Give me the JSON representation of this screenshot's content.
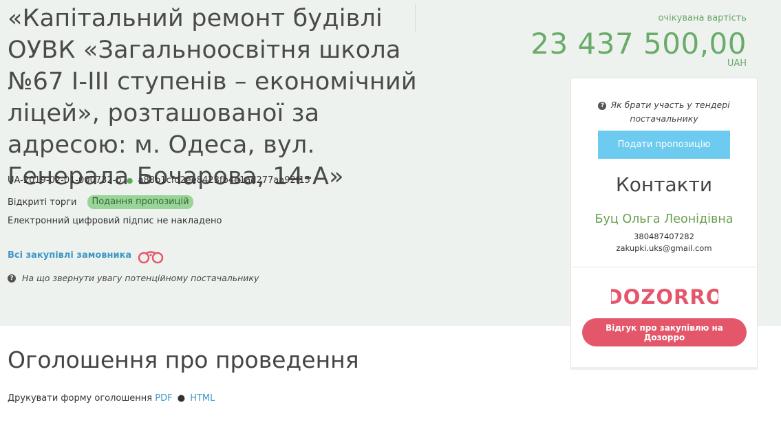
{
  "tender": {
    "title": "«Капітальний ремонт будівлі ОУВК «Загальноосвітня школа №67 І-ІІІ ступенів – економічний ліцей», розташованої за адресою: м. Одеса, вул. Генерала Бочарова, 14-А»",
    "id": "UA-2019-02-01-000732-b",
    "hash": "a88b1cfd2ee8423fb4e1ad277aa92f15",
    "procedure_type": "Відкриті торги",
    "status": "Подання пропозицій",
    "signature_note": "Електронний цифровий підпис не накладено",
    "all_purchases_link": "Всі закупівлі замовника",
    "hint": "На що звернути увагу потенційному постачальнику"
  },
  "value": {
    "label": "очікувана вартість",
    "amount": "23 437 500,00",
    "currency": "UAH"
  },
  "panel": {
    "how_to": "Як брати участь у тендері постачальнику",
    "submit_label": "Подати пропозицію",
    "contacts_title": "Контакти",
    "contact_name": "Буц Ольга Леонідівна",
    "contact_phone": "380487407282",
    "contact_email": "zakupki.uks@gmail.com",
    "dozorro_logo_text": "DOZORRO",
    "dozorro_button": "Відгук про закупівлю на Дозорро"
  },
  "announcement": {
    "title": "Оголошення про проведення",
    "print_label": "Друкувати форму оголошення",
    "pdf": "PDF",
    "html": "HTML"
  },
  "colors": {
    "accent_green": "#6aab6a",
    "link_blue": "#3e97c7",
    "button_blue": "#6ccbef",
    "dozorro_red": "#e4576a",
    "status_badge": "#9bd49b"
  },
  "icons": [
    "question-circle-icon",
    "binoculars-icon",
    "dozorro-logo"
  ]
}
